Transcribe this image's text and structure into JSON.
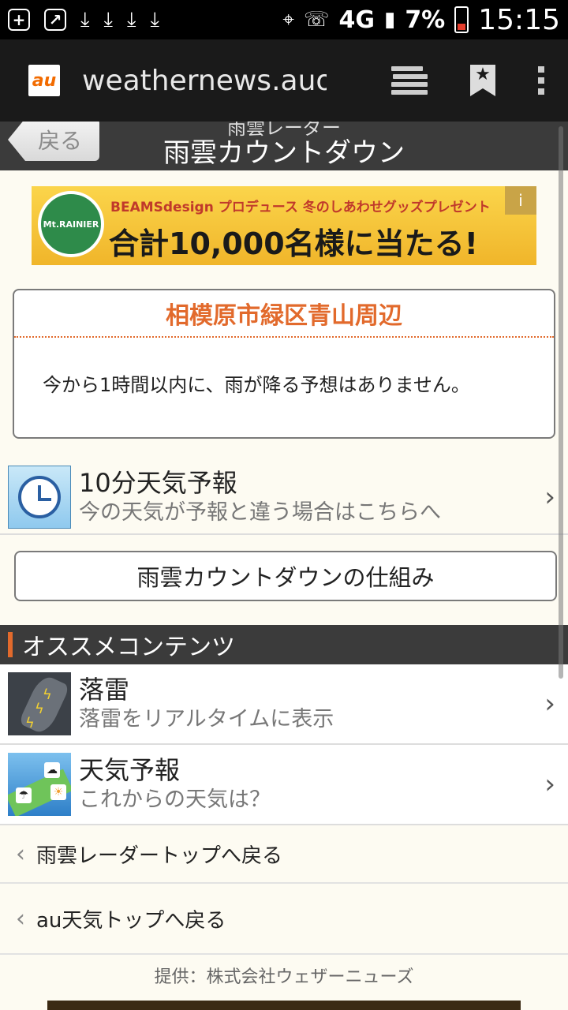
{
  "status_bar": {
    "network": "4G",
    "battery": "7%",
    "time": "15:15"
  },
  "browser": {
    "url": "weathernews.auone",
    "logo_text": "au"
  },
  "header": {
    "back_label": "戻る",
    "subtitle": "雨雲レーダー",
    "title": "雨雲カウントダウン"
  },
  "ad": {
    "badge": "Mt.RAINIER",
    "line1": "BEAMSdesign プロデュース 冬のしあわせグッズプレゼント",
    "line2": "合計10,000名様に当たる!",
    "info": "i"
  },
  "location_card": {
    "title": "相模原市緑区青山周辺",
    "message": "今から1時間以内に、雨が降る予想はありません。"
  },
  "forecast_10min": {
    "title": "10分天気予報",
    "subtitle": "今の天気が予報と違う場合はこちらへ"
  },
  "mechanism_button": "雨雲カウントダウンの仕組み",
  "recommended": {
    "heading": "オススメコンテンツ",
    "items": [
      {
        "title": "落雷",
        "subtitle": "落雷をリアルタイムに表示",
        "icon": "lightning-map-icon"
      },
      {
        "title": "天気予報",
        "subtitle": "これからの天気は？",
        "icon": "forecast-map-icon"
      }
    ]
  },
  "links": {
    "radar_top": "雨雲レーダートップへ戻る",
    "au_top": "au天気トップへ戻る"
  },
  "credit": "提供：株式会社ウェザーニューズ",
  "colors": {
    "accent": "#e26a2c",
    "header_bg": "#3b3b3b",
    "page_bg": "#fdfbf2"
  }
}
